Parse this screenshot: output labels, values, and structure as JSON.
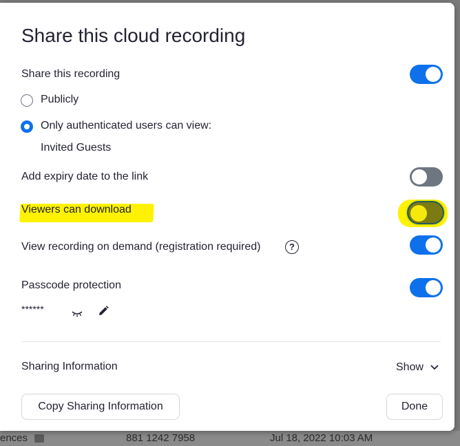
{
  "dialog": {
    "title": "Share this cloud recording",
    "share_recording": {
      "label": "Share this recording",
      "enabled": true
    },
    "visibility_options": [
      {
        "label": "Publicly",
        "selected": false
      },
      {
        "label": "Only authenticated users can view:",
        "selected": true
      }
    ],
    "authenticated_value": "Invited Guests",
    "expiry": {
      "label": "Add expiry date to the link",
      "enabled": false
    },
    "download": {
      "label": "Viewers can download",
      "enabled": false
    },
    "on_demand": {
      "label": "View recording on demand (registration required)",
      "help": "?",
      "enabled": true
    },
    "passcode": {
      "label": "Passcode protection",
      "enabled": true,
      "masked_value": "******"
    },
    "sharing_info": {
      "label": "Sharing Information",
      "toggle_text": "Show"
    },
    "buttons": {
      "copy": "Copy Sharing Information",
      "done": "Done"
    }
  },
  "background_row": {
    "left_text": "ences",
    "middle_text": "881 1242 7958",
    "right_text": "Jul 18, 2022 10:03 AM"
  },
  "colors": {
    "accent_blue": "#0e71eb",
    "toggle_off": "#6e7680",
    "highlight": "#fff200",
    "text": "#232333"
  }
}
